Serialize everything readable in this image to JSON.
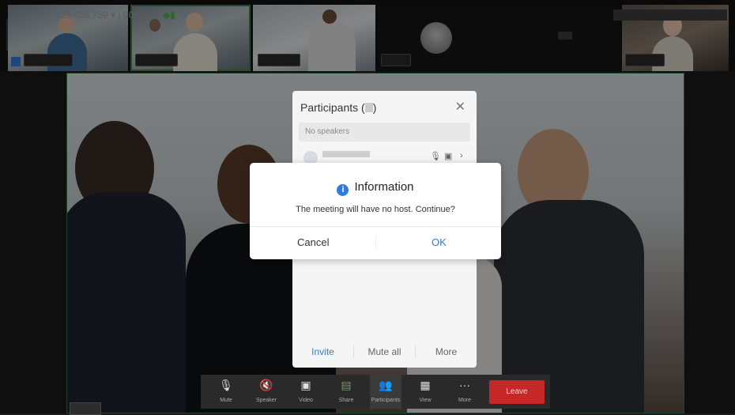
{
  "top": {
    "meeting_id": "123 456 789",
    "timer": "00:03:45"
  },
  "participants_panel": {
    "title": "Participants (",
    "title_end": ")",
    "no_speakers": "No speakers",
    "actions": {
      "invite": "Invite",
      "mute_all": "Mute all",
      "more": "More"
    }
  },
  "dialog": {
    "title": "Information",
    "message": "The meeting will have no host. Continue?",
    "cancel": "Cancel",
    "ok": "OK"
  },
  "toolbar": {
    "mute": "Mute",
    "speaker": "Speaker",
    "video": "Video",
    "share": "Share",
    "participants": "Participants",
    "view": "View",
    "more": "More",
    "leave": "Leave"
  },
  "colors": {
    "accent": "#2f7fd8",
    "leave": "#c62828",
    "selected_border": "#3d7d4c"
  }
}
